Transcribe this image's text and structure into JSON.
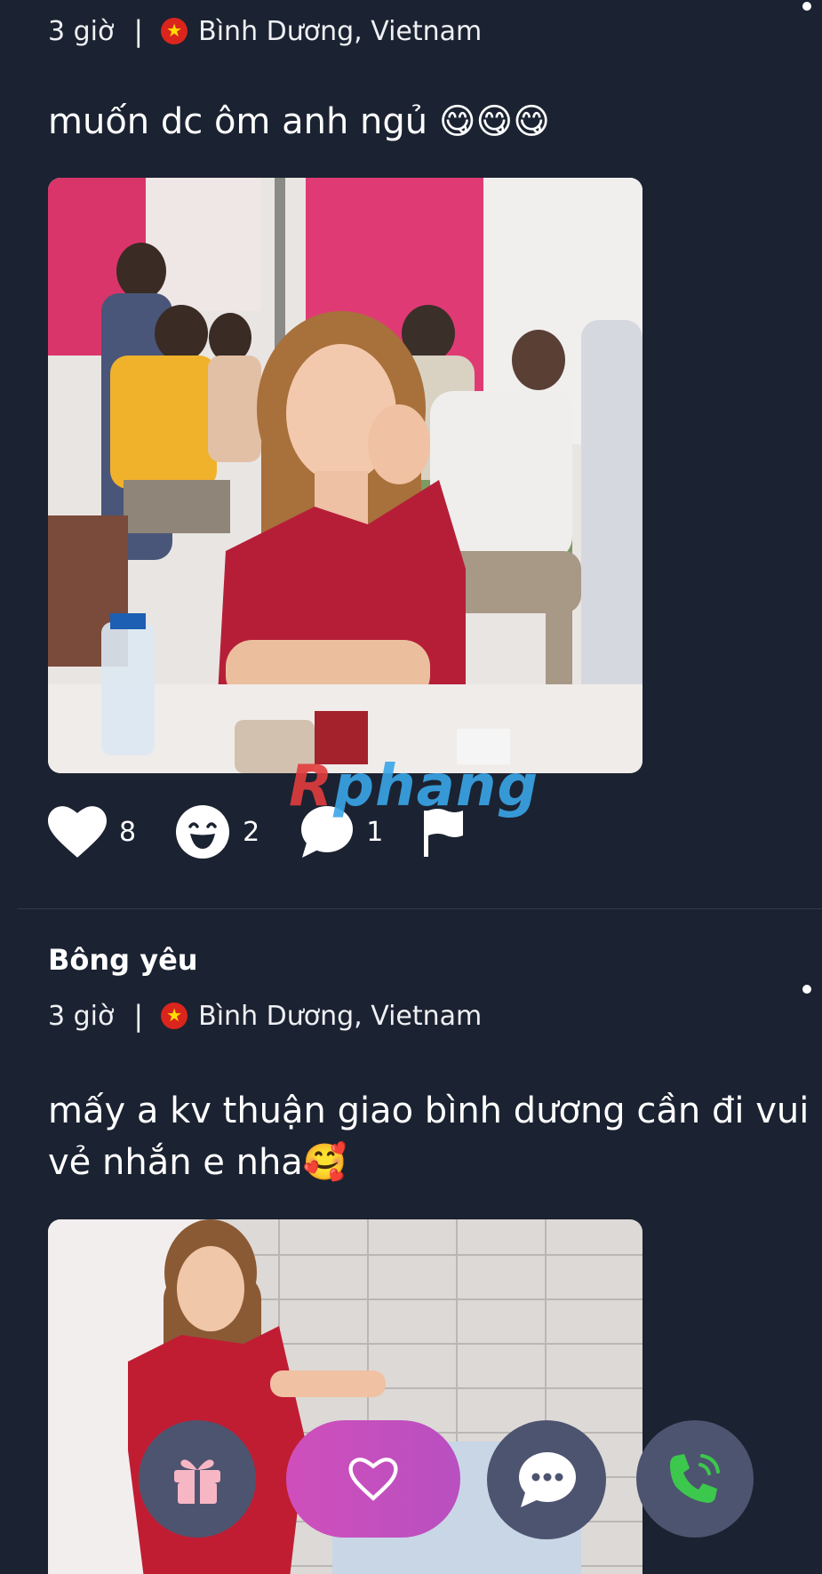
{
  "posts": [
    {
      "time": "3 giờ",
      "separator": "|",
      "location": "Bình Dương, Vietnam",
      "text": "muốn dc ôm anh ngủ 😋😋😋",
      "stats": {
        "likes": "8",
        "smiles": "2",
        "comments": "1"
      }
    },
    {
      "author": "Bông yêu",
      "time": "3 giờ",
      "separator": "|",
      "location": "Bình Dương, Vietnam",
      "text": "mấy a kv thuận giao bình dương cần đi vui vẻ nhắn e nha🥰"
    }
  ],
  "watermark": {
    "first": "R",
    "rest": "phang"
  },
  "icons": {
    "like": "heart-icon",
    "smile": "laugh-icon",
    "comment": "speech-bubble-icon",
    "report": "flag-icon",
    "gift": "gift-icon",
    "match": "heart-outline-icon",
    "chat": "chat-dots-icon",
    "call": "phone-ringing-icon"
  },
  "colors": {
    "background": "#1b2231",
    "gift_button": "#4d5470",
    "heart_button": "#c44fbd",
    "chat_button": "#4d5470",
    "call_button": "#4d5470",
    "call_icon": "#3cc84c",
    "gift_icon": "#f7b6c4"
  }
}
